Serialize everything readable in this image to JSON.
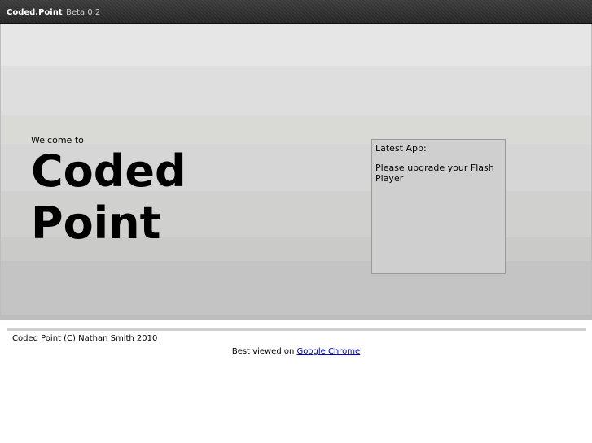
{
  "header": {
    "brand": "Coded.Point",
    "version": "Beta 0.2"
  },
  "hero": {
    "welcome": "Welcome to",
    "title_line1": "Coded",
    "title_line2": "Point"
  },
  "latest_app": {
    "heading": "Latest App:",
    "message": "Please upgrade your Flash Player"
  },
  "footer": {
    "copyright": "Coded Point (C) Nathan Smith 2010",
    "best_viewed_prefix": "Best viewed on",
    "browser_link": "Google Chrome",
    "link_color": "#0000cc"
  }
}
